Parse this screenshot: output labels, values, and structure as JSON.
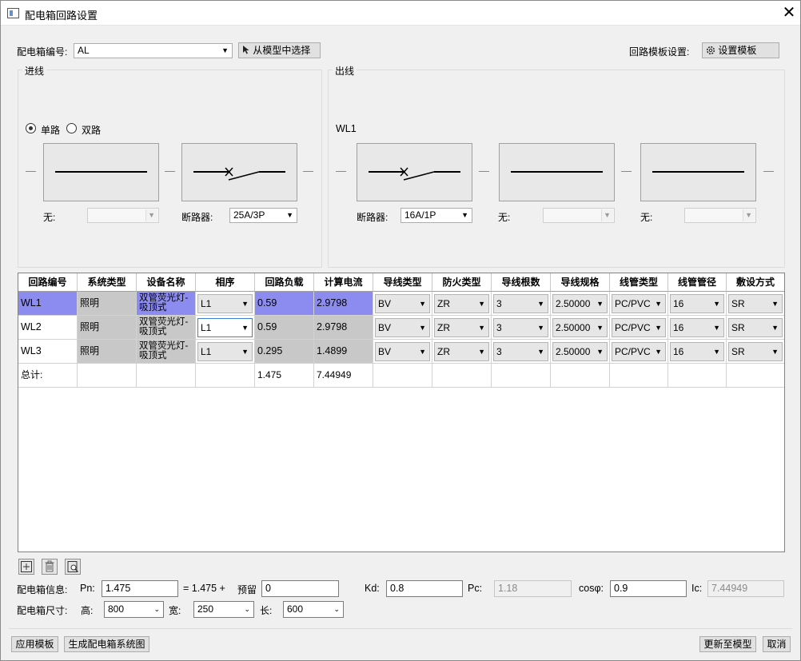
{
  "window": {
    "title": "配电箱回路设置",
    "close_glyph": "✕"
  },
  "top": {
    "box_no_label": "配电箱编号:",
    "box_no_value": "AL",
    "pick_button": "从模型中选择",
    "template_label": "回路模板设置:",
    "template_button": "设置模板"
  },
  "incoming": {
    "group_title": "进线",
    "radio_single": "单路",
    "radio_double": "双路",
    "device1_label": "无:",
    "device1_value": "",
    "device2_label": "断路器:",
    "device2_value": "25A/3P"
  },
  "outgoing": {
    "group_title": "出线",
    "circuit_name": "WL1",
    "device1_label": "断路器:",
    "device1_value": "16A/1P",
    "device2_label": "无:",
    "device2_value": "",
    "device3_label": "无:",
    "device3_value": ""
  },
  "table": {
    "headers": [
      "回路编号",
      "系统类型",
      "设备名称",
      "相序",
      "回路负载",
      "计算电流",
      "导线类型",
      "防火类型",
      "导线根数",
      "导线规格",
      "线管类型",
      "线管管径",
      "敷设方式"
    ],
    "rows": [
      [
        "WL1",
        "照明",
        "双管荧光灯-吸顶式",
        "L1",
        "0.59",
        "2.9798",
        "BV",
        "ZR",
        "3",
        "2.50000",
        "PC/PVC",
        "16",
        "SR"
      ],
      [
        "WL2",
        "照明",
        "双管荧光灯-吸顶式",
        "L1",
        "0.59",
        "2.9798",
        "BV",
        "ZR",
        "3",
        "2.50000",
        "PC/PVC",
        "16",
        "SR"
      ],
      [
        "WL3",
        "照明",
        "双管荧光灯-吸顶式",
        "L1",
        "0.295",
        "1.4899",
        "BV",
        "ZR",
        "3",
        "2.50000",
        "PC/PVC",
        "16",
        "SR"
      ]
    ],
    "total_label": "总计:",
    "total_load": "1.475",
    "total_current": "7.44949"
  },
  "toolbar_icons": [
    "add-icon",
    "delete-icon",
    "find-icon"
  ],
  "info": {
    "label": "配电箱信息:",
    "pn_label": "Pn:",
    "pn_value": "1.475",
    "equals_text": "= 1.475 +",
    "reserve_label": "预留",
    "reserve_value": "0",
    "kd_label": "Kd:",
    "kd_value": "0.8",
    "pc_label": "Pc:",
    "pc_value": "1.18",
    "cos_label": "cosφ:",
    "cos_value": "0.9",
    "ic_label": "Ic:",
    "ic_value": "7.44949"
  },
  "size": {
    "label": "配电箱尺寸:",
    "height_label": "高:",
    "height_value": "800",
    "width_label": "宽:",
    "width_value": "250",
    "length_label": "长:",
    "length_value": "600"
  },
  "bottom": {
    "apply_template": "应用模板",
    "generate": "生成配电箱系统图",
    "update_model": "更新至模型",
    "cancel": "取消"
  }
}
